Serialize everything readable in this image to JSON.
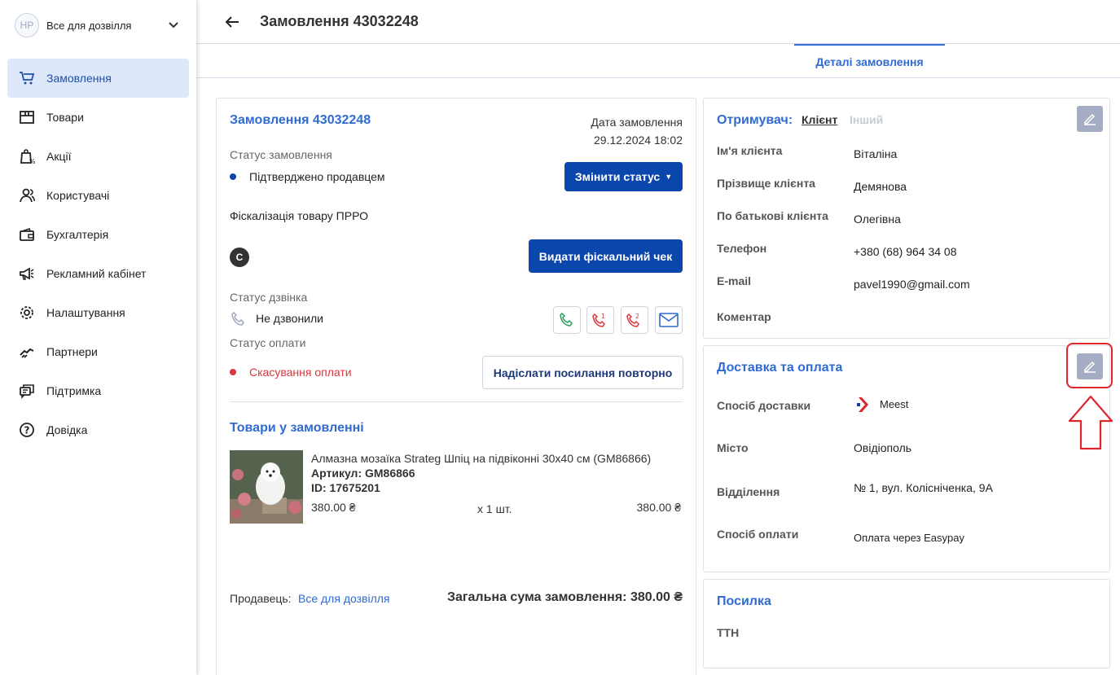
{
  "sidebar": {
    "avatar_initials": "НР",
    "store_name": "Все для дозвілля",
    "items": [
      {
        "label": "Замовлення",
        "icon": "cart-icon"
      },
      {
        "label": "Товари",
        "icon": "box-icon"
      },
      {
        "label": "Акції",
        "icon": "promo-bag-icon"
      },
      {
        "label": "Користувачі",
        "icon": "users-icon"
      },
      {
        "label": "Бухгалтерія",
        "icon": "wallet-icon"
      },
      {
        "label": "Рекламний кабінет",
        "icon": "megaphone-icon"
      },
      {
        "label": "Налаштування",
        "icon": "gear-icon"
      },
      {
        "label": "Партнери",
        "icon": "handshake-icon"
      },
      {
        "label": "Підтримка",
        "icon": "chat-icon"
      },
      {
        "label": "Довідка",
        "icon": "help-icon"
      }
    ]
  },
  "header": {
    "title": "Замовлення 43032248"
  },
  "tabs": {
    "active": "Деталі замовлення"
  },
  "order": {
    "title": "Замовлення 43032248",
    "date_label": "Дата замовлення",
    "date_value": "29.12.2024 18:02",
    "status_label": "Статус замовлення",
    "status_value": "Підтверджено продавцем",
    "change_status_btn": "Змінити статус",
    "fiscal_label": "Фіскалізація товару ПРРО",
    "fiscal_badge": "C",
    "fiscal_btn": "Видати фіскальний чек",
    "call_status_label": "Статус дзвінка",
    "call_status_value": "Не дзвонили",
    "call_btn_1": "1",
    "call_btn_2": "2",
    "payment_status_label": "Статус оплати",
    "payment_status_value": "Скасування оплати",
    "resend_btn": "Надіслати посилання повторно",
    "items_title": "Товари у замовленні",
    "item": {
      "name": "Алмазна мозаїка Strateg Шпіц на підвіконні 30х40 см (GM86866)",
      "sku": "Артикул: GM86866",
      "id": "ID: 17675201",
      "price": "380.00 ₴",
      "qty": "х 1 шт.",
      "total": "380.00 ₴"
    },
    "seller_label": "Продавець:",
    "seller_value": "Все для дозвілля",
    "grand_total": "Загальна сума замовлення: 380.00 ₴"
  },
  "recipient": {
    "title": "Отримувач:",
    "tab_client": "Клієнт",
    "tab_other": "Інший",
    "rows": [
      {
        "label": "Ім'я клієнта",
        "value": "Віталіна"
      },
      {
        "label": "Прізвище клієнта",
        "value": "Демянова"
      },
      {
        "label": "По батькові клієнта",
        "value": "Олегівна"
      },
      {
        "label": "Телефон",
        "value": "+380 (68) 964 34 08"
      },
      {
        "label": "E-mail",
        "value": "pavel1990@gmail.com"
      },
      {
        "label": "Коментар",
        "value": ""
      }
    ]
  },
  "delivery": {
    "title": "Доставка та оплата",
    "rows": [
      {
        "label": "Спосіб доставки",
        "value": "Meest"
      },
      {
        "label": "Місто",
        "value": "Овідіополь"
      },
      {
        "label": "Відділення",
        "value": "№ 1, вул. Колісніченка, 9А"
      },
      {
        "label": "Спосіб оплати",
        "value": "Оплата через Easypay"
      }
    ]
  },
  "parcel": {
    "title": "Посилка",
    "ttn_label": "ТТН"
  },
  "colors": {
    "accent": "#0b46ad",
    "link": "#2f6bd1",
    "danger": "#d9363e",
    "highlight": "#e0242c"
  }
}
